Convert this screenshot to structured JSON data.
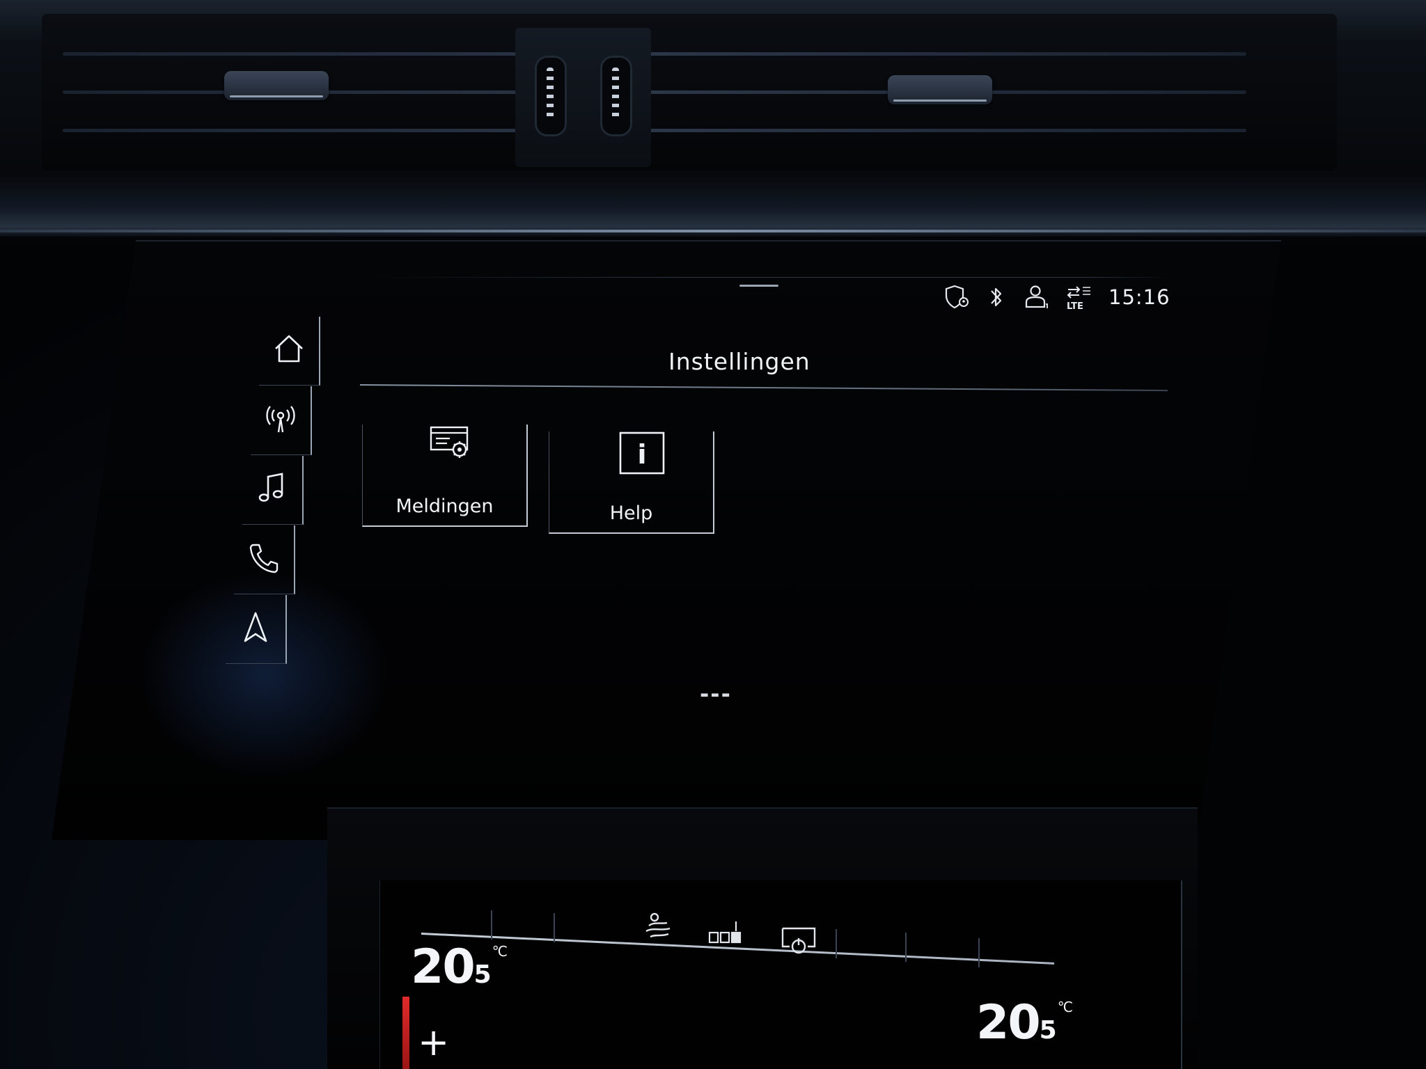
{
  "status_bar": {
    "time": "15:16",
    "network": "LTE",
    "icons": [
      "privacy-location-icon",
      "bluetooth-icon",
      "user-profile-icon",
      "lte-data-icon"
    ]
  },
  "side_nav": {
    "items": [
      {
        "name": "home-icon"
      },
      {
        "name": "radio-icon"
      },
      {
        "name": "music-icon"
      },
      {
        "name": "phone-icon"
      },
      {
        "name": "navigation-icon"
      }
    ]
  },
  "page": {
    "title": "Instellingen"
  },
  "tiles": [
    {
      "label": "Meldingen",
      "icon": "notifications-settings-icon"
    },
    {
      "label": "Help",
      "icon": "info-icon",
      "icon_glyph": "i"
    }
  ],
  "placeholder": "---",
  "climate": {
    "left_temp": {
      "whole": "20",
      "decimal": "5",
      "unit": "°C"
    },
    "right_temp": {
      "whole": "20",
      "decimal": "5",
      "unit": "°C"
    },
    "plus_label": "+",
    "icons": [
      "air-distribution-icon",
      "seat-heating-icon",
      "climate-power-icon"
    ]
  },
  "colors": {
    "screen_bg": "#010102",
    "text": "#f1f4f7",
    "accent_red": "#e02b2b"
  }
}
